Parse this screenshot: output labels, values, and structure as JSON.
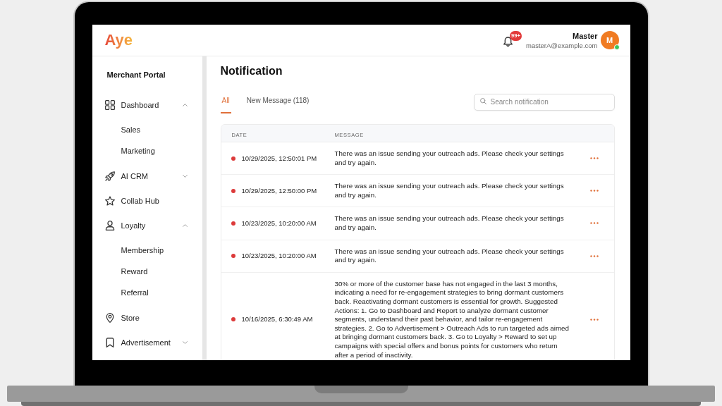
{
  "header": {
    "logo": "Aye",
    "notification_badge": "99+",
    "user": {
      "name": "Master",
      "email": "masterA@example.com",
      "initial": "M",
      "online": true
    }
  },
  "sidebar": {
    "title": "Merchant Portal",
    "items": [
      {
        "label": "Dashboard",
        "kind": "group",
        "expanded": true,
        "children": [
          {
            "label": "Sales"
          },
          {
            "label": "Marketing"
          }
        ]
      },
      {
        "label": "AI CRM",
        "kind": "group",
        "expanded": false
      },
      {
        "label": "Collab Hub",
        "kind": "link"
      },
      {
        "label": "Loyalty",
        "kind": "group",
        "expanded": true,
        "children": [
          {
            "label": "Membership"
          },
          {
            "label": "Reward"
          },
          {
            "label": "Referral"
          }
        ]
      },
      {
        "label": "Store",
        "kind": "link"
      },
      {
        "label": "Advertisement",
        "kind": "group",
        "expanded": false
      }
    ]
  },
  "page": {
    "title": "Notification",
    "tabs": [
      {
        "label": "All",
        "selected": true
      },
      {
        "label": "New Message (118)",
        "selected": false
      }
    ],
    "search": {
      "placeholder": "Search notification"
    },
    "table": {
      "columns": [
        "DATE",
        "MESSAGE"
      ],
      "rows": [
        {
          "date": "10/29/2025, 12:50:01 PM",
          "message": "There was an issue sending your outreach ads. Please check your settings and try again.",
          "unread": true
        },
        {
          "date": "10/29/2025, 12:50:00 PM",
          "message": "There was an issue sending your outreach ads. Please check your settings and try again.",
          "unread": true
        },
        {
          "date": "10/23/2025, 10:20:00 AM",
          "message": "There was an issue sending your outreach ads. Please check your settings and try again.",
          "unread": true
        },
        {
          "date": "10/23/2025, 10:20:00 AM",
          "message": "There was an issue sending your outreach ads. Please check your settings and try again.",
          "unread": true
        },
        {
          "date": "10/16/2025, 6:30:49 AM",
          "message": "30% or more of the customer base has not engaged in the last 3 months, indicating a need for re-engagement strategies to bring dormant customers back. Reactivating dormant customers is essential for growth. Suggested Actions: 1. Go to Dashboard and Report to analyze dormant customer segments, understand their past behavior, and tailor re-engagement strategies. 2. Go to Advertisement > Outreach Ads to run targeted ads aimed at bringing dormant customers back. 3. Go to Loyalty > Reward to set up campaigns with special offers and bonus points for customers who return after a period of inactivity.",
          "unread": true
        }
      ]
    }
  }
}
